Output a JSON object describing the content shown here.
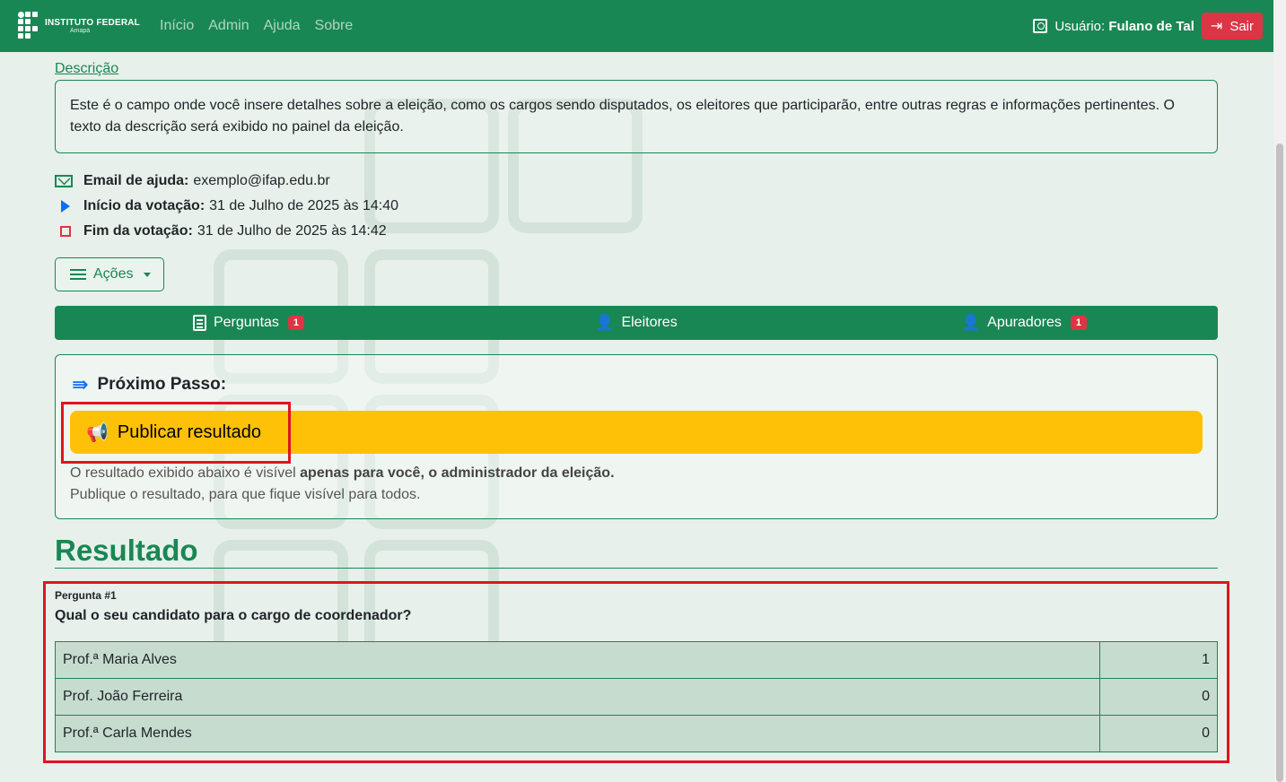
{
  "navbar": {
    "brand_title": "INSTITUTO FEDERAL",
    "brand_sub": "Amapá",
    "links": [
      "Início",
      "Admin",
      "Ajuda",
      "Sobre"
    ],
    "user_label": "Usuário:",
    "user_name": "Fulano de Tal",
    "logout_label": "Sair"
  },
  "description": {
    "link_label": "Descrição",
    "text": "Este é o campo onde você insere detalhes sobre a eleição, como os cargos sendo disputados, os eleitores que participarão, entre outras regras e informações pertinentes. O texto da descrição será exibido no painel da eleição."
  },
  "info": {
    "email_label": "Email de ajuda:",
    "email_value": "exemplo@ifap.edu.br",
    "start_label": "Início da votação:",
    "start_value": "31 de Julho de 2025 às 14:40",
    "end_label": "Fim da votação:",
    "end_value": "31 de Julho de 2025 às 14:42"
  },
  "actions": {
    "label": "Ações"
  },
  "tabs": [
    {
      "label": "Perguntas",
      "badge": "1"
    },
    {
      "label": "Eleitores",
      "badge": ""
    },
    {
      "label": "Apuradores",
      "badge": "1"
    }
  ],
  "next_step": {
    "title": "Próximo Passo:",
    "button_label": "Publicar resultado",
    "text_before": "O resultado exibido abaixo é visível",
    "text_bold": "apenas para você, o administrador da eleição.",
    "text_line2": "Publique o resultado, para que fique visível para todos."
  },
  "result": {
    "title": "Resultado",
    "question_label": "Pergunta #1",
    "question_text": "Qual o seu candidato para o cargo de coordenador?",
    "rows": [
      {
        "name": "Prof.ª Maria Alves",
        "votes": "1"
      },
      {
        "name": "Prof. João Ferreira",
        "votes": "0"
      },
      {
        "name": "Prof.ª Carla Mendes",
        "votes": "0"
      }
    ]
  },
  "colors": {
    "primary": "#198754",
    "danger": "#dc3545",
    "warning": "#ffc107",
    "info": "#0d6efd",
    "highlight": "#e0141e"
  },
  "icons": [
    "user-badge-icon",
    "logout-icon",
    "mail-icon",
    "play-icon",
    "stop-icon",
    "menu-icon",
    "caret-down-icon",
    "document-icon",
    "user-check-icon",
    "user-gear-icon",
    "forward-arrow-icon",
    "megaphone-icon"
  ]
}
